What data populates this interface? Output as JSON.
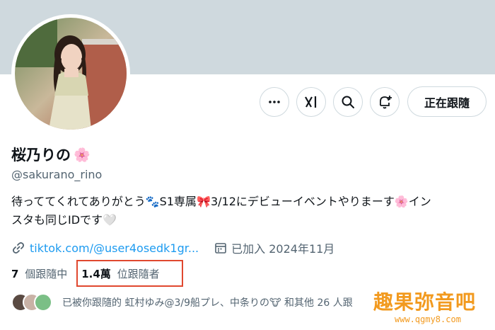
{
  "profile": {
    "display_name": "桜乃りの",
    "name_emoji": "🌸",
    "handle": "@sakurano_rino",
    "bio_line1": "待っててくれてありがとう🐾S1専属🎀3/12にデビューイベントやりまーす🌸イン",
    "bio_line2": "スタも同じIDです🤍",
    "link_text": "tiktok.com/@user4osedk1gr...",
    "joined_text": "已加入 2024年11月"
  },
  "actions": {
    "more_icon": "more-horizontal-icon",
    "grok_icon": "grok-icon",
    "search_icon": "search-icon",
    "notify_icon": "bell-plus-icon",
    "follow_label": "正在跟隨"
  },
  "stats": {
    "following_count": "7",
    "following_label": "個跟隨中",
    "followers_count": "1.4萬",
    "followers_label": "位跟隨者"
  },
  "followed_by": {
    "text": "已被你跟隨的 虹村ゆみ@3/9船プレ、中条りの🐮 和其他 26 人跟"
  },
  "watermark": {
    "title": "趣果弥音吧",
    "url": "www.qgmy8.com"
  },
  "colors": {
    "banner": "#cfd9de",
    "link": "#1d9bf0",
    "secondary_text": "#536471",
    "highlight": "#e0482f",
    "watermark": "#f29a1f"
  }
}
